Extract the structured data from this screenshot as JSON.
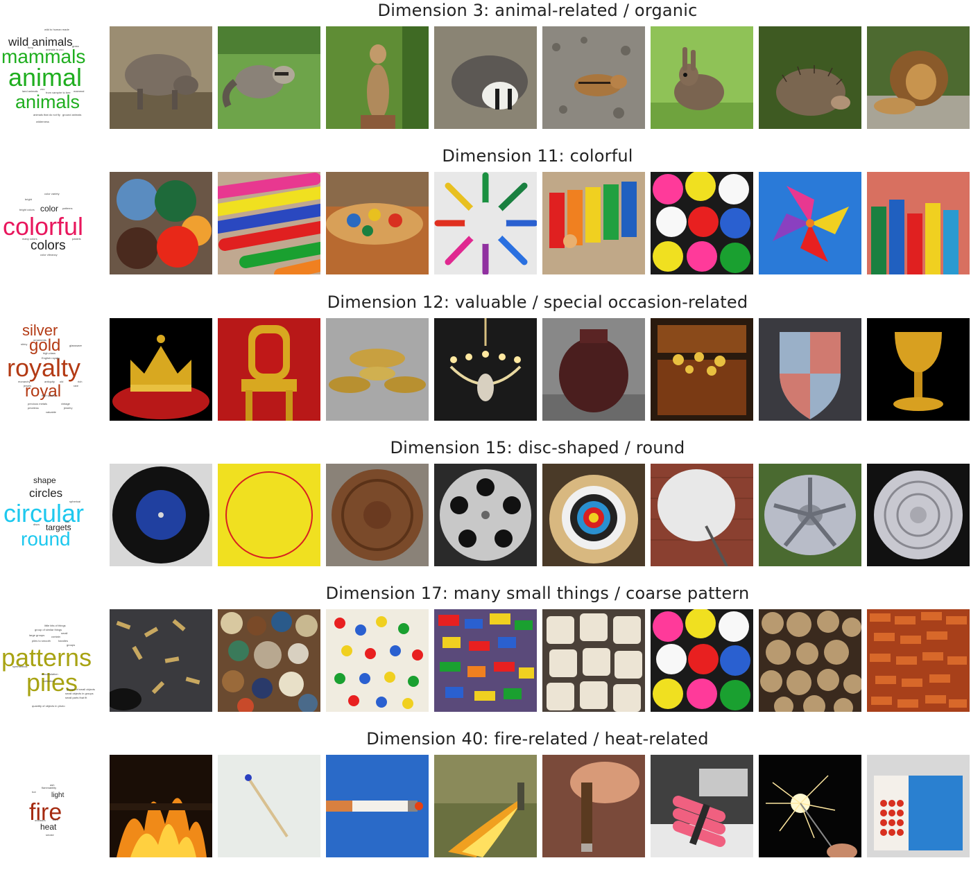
{
  "rows": [
    {
      "title": "Dimension 3: animal-related / organic",
      "color": "#1fae1f",
      "cloud": [
        "wild animals",
        "mammals",
        "animal",
        "animals",
        "wild to human made",
        "furry",
        "animals in zoo",
        "grass",
        "land animals",
        "zoo",
        "from vampire to bee",
        "mammal",
        "animals that do not fly",
        "ground animals",
        "wilderness",
        "..."
      ],
      "images": [
        "boar-photo",
        "raccoon-photo",
        "meerkat-photo",
        "badger-photo",
        "chipmunk-photo",
        "rabbit-photo",
        "hedgehog-photo",
        "lion-photo"
      ]
    },
    {
      "title": "Dimension 11: colorful",
      "color": "#e8175d",
      "cloud": [
        "color variety",
        "bright",
        "color",
        "patterns",
        "bright colors",
        "colorful",
        "colors",
        "many colors",
        "pastels",
        "color vibrancy"
      ],
      "images": [
        "paint-pots-photo",
        "crayons-photo",
        "paint-palette-photo",
        "felt-pens-photo",
        "xylophone-photo",
        "gumballs-photo",
        "pinwheel-photo",
        "toy-tubes-photo"
      ]
    },
    {
      "title": "Dimension 12: valuable / special occasion-related",
      "color": "#b33a14",
      "cloud": [
        "silver",
        "ornaments",
        "gold",
        "glassware",
        "shiny",
        "royalty",
        "royal",
        "high-class",
        "English royalty",
        "jewels",
        "monarchy",
        "antiquity",
        "precious metals",
        "priceless",
        "high quality",
        "old",
        "vintage",
        "valuable",
        "jewelry",
        "rich",
        "rare"
      ],
      "images": [
        "crown-photo",
        "throne-photo",
        "gold-dishes-photo",
        "chandelier-photo",
        "vase-photo",
        "treasure-chest-photo",
        "shield-photo",
        "goblet-photo"
      ]
    },
    {
      "title": "Dimension 15: disc-shaped / round",
      "color": "#1ec8ee",
      "cloud": [
        "shape",
        "circles",
        "spherical",
        "circular",
        "targets",
        "round",
        "discs",
        "lids",
        "fill"
      ],
      "images": [
        "vinyl-record-photo",
        "frisbee-photo",
        "manhole-cover-photo",
        "film-reel-photo",
        "archery-target-photo",
        "satellite-dish-photo",
        "hubcap-photo",
        "doily-photo"
      ]
    },
    {
      "title": "Dimension 17: many small things / coarse pattern",
      "color": "#a8a313",
      "cloud": [
        "little bits of things",
        "group of similar things",
        "small",
        "large groups",
        "contain",
        "piles to smooth",
        "handles",
        "groups",
        "patterns",
        "piles",
        "symmetrical",
        "accumulation",
        "collection",
        "groups of small objects",
        "small objects in groups",
        "quantity of objects in photo",
        "small parts that fit"
      ],
      "images": [
        "bullet-shells-photo",
        "buttons-photo",
        "push-pins-photo",
        "lego-bricks-photo",
        "cups-photo",
        "gumballs-2-photo",
        "firewood-photo",
        "bricks-photo"
      ]
    },
    {
      "title": "Dimension 40: fire-related / heat-related",
      "color": "#a52a10",
      "cloud": [
        "flammability",
        "fire",
        "light",
        "heat",
        "ash",
        "outdoors",
        "hot",
        "burn",
        "smoke"
      ],
      "images": [
        "campfire-photo",
        "match-photo",
        "cigarette-photo",
        "flamethrower-photo",
        "cigar-photo",
        "dynamite-photo",
        "sparkler-photo",
        "matchbox-photo"
      ]
    }
  ]
}
